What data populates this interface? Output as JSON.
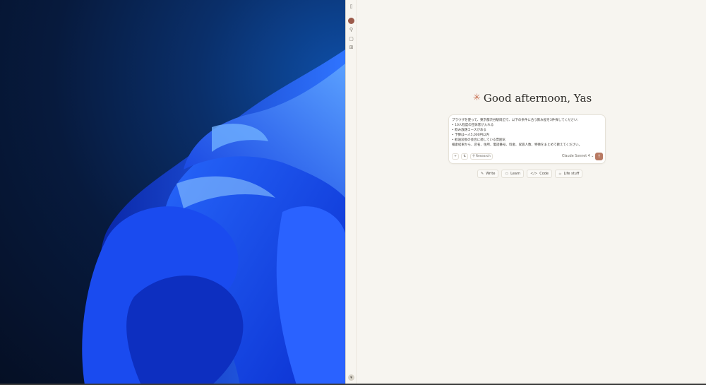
{
  "app": {
    "greeting": "Good afternoon, Yas",
    "spark_icon": "✳",
    "composer": {
      "lines": [
        "ブラウザを使って、東京都渋谷駅周辺で、以下の条件に合う飲み屋を3件探してください：",
        "• 10人程度の団体客が入れる",
        "• 飲み放題コースがある",
        "• 予算は一人5,000円以内",
        "• 歓送迎会の会合に適している雰囲気",
        "検索結果から、店名、住所、電話番号、料金、収容人数、特徴をまとめて教えてください。"
      ],
      "plus": "+",
      "settings": "⇅",
      "research": "Research",
      "model": "Claude Sonnet 4",
      "send": "↑"
    },
    "chips": [
      {
        "icon": "✎",
        "label": "Write"
      },
      {
        "icon": "▭",
        "label": "Learn"
      },
      {
        "icon": "</>",
        "label": "Code"
      },
      {
        "icon": "☕",
        "label": "Life stuff"
      }
    ],
    "accent": "#c76e4f"
  }
}
